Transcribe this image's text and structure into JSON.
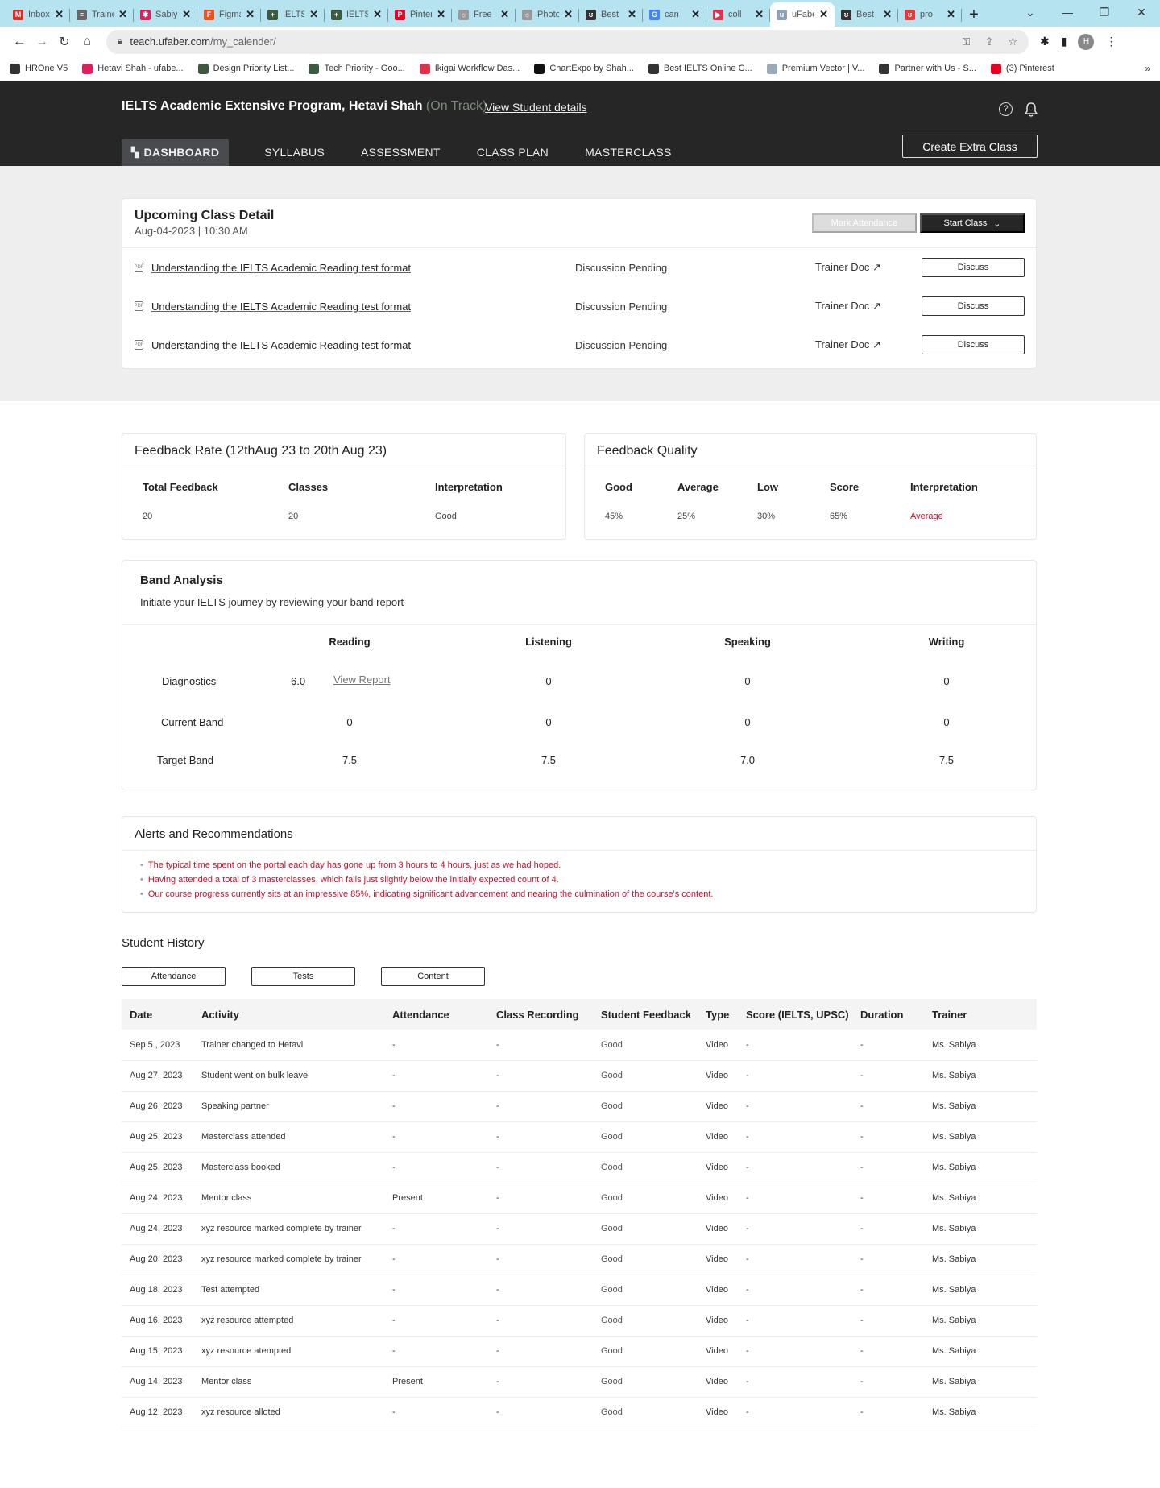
{
  "browser": {
    "tabs": [
      {
        "label": "Inbox",
        "icon": "gmail-icon",
        "color": "#d93025",
        "glyph": "M"
      },
      {
        "label": "Trainer",
        "icon": "document-icon",
        "color": "#666666",
        "glyph": "≡"
      },
      {
        "label": "Sabiya",
        "icon": "slack-icon",
        "color": "#e01e5a",
        "glyph": "✱"
      },
      {
        "label": "Figma",
        "icon": "figma-icon",
        "color": "#f24e1e",
        "glyph": "F"
      },
      {
        "label": "IELTS",
        "icon": "sheets-icon",
        "color": "#3e5a3e",
        "glyph": "+"
      },
      {
        "label": "IELTS",
        "icon": "sheets-icon",
        "color": "#3e5a3e",
        "glyph": "+"
      },
      {
        "label": "Pinterest",
        "icon": "pinterest-icon",
        "color": "#e60023",
        "glyph": "P"
      },
      {
        "label": "Free",
        "icon": "vector-icon",
        "color": "#999999",
        "glyph": "☼"
      },
      {
        "label": "Photo",
        "icon": "vector-icon",
        "color": "#999999",
        "glyph": "☼"
      },
      {
        "label": "Best",
        "icon": "ufaber-icon",
        "color": "#333333",
        "glyph": "ʊ"
      },
      {
        "label": "can",
        "icon": "google-icon",
        "color": "#4285f4",
        "glyph": "G"
      },
      {
        "label": "coll",
        "icon": "youtube-icon",
        "color": "#e62e4d",
        "glyph": "▶"
      },
      {
        "label": "uFaber",
        "icon": "ufaber-icon",
        "color": "#8fa3b8",
        "glyph": "u",
        "active": true
      },
      {
        "label": "Best",
        "icon": "ufaber-icon",
        "color": "#333333",
        "glyph": "ʊ"
      },
      {
        "label": "pro",
        "icon": "ufaber-icon",
        "color": "#e53935",
        "glyph": "ʊ"
      }
    ],
    "url_host": "teach.ufaber.com",
    "url_path": "/my_calender/",
    "avatar_letter": "H",
    "bookmarks": [
      {
        "label": "HROne V5",
        "color": "#333333"
      },
      {
        "label": "Hetavi Shah - ufabe...",
        "color": "#e01e5a"
      },
      {
        "label": "Design Priority List...",
        "color": "#3e5a3e"
      },
      {
        "label": "Tech Priority - Goo...",
        "color": "#3e5a3e"
      },
      {
        "label": "Ikigai Workflow Das...",
        "color": "#e0304a"
      },
      {
        "label": "ChartExpo by Shah...",
        "color": "#111111"
      },
      {
        "label": "Best IELTS Online C...",
        "color": "#333333"
      },
      {
        "label": "Premium Vector | V...",
        "color": "#9aaab8"
      },
      {
        "label": "Partner with Us - S...",
        "color": "#333333"
      },
      {
        "label": "(3) Pinterest",
        "color": "#e60023"
      }
    ],
    "bookmarks_more": "»"
  },
  "header": {
    "title": "IELTS Academic Extensive Program, Hetavi Shah",
    "status": "(On Track)",
    "view_student_details": "View Student details",
    "create_extra_class": "Create Extra Class",
    "nav": [
      {
        "label": "DASHBOARD",
        "active": true
      },
      {
        "label": "SYLLABUS"
      },
      {
        "label": "ASSESSMENT"
      },
      {
        "label": "CLASS PLAN"
      },
      {
        "label": "MASTERCLASS"
      }
    ]
  },
  "upcoming": {
    "title": "Upcoming Class Detail",
    "datetime": "Aug-04-2023 | 10:30 AM",
    "mark_attendance": "Mark Attendance",
    "start_class": "Start Class",
    "rows": [
      {
        "topic": "Understanding the IELTS Academic Reading test format",
        "status": "Discussion Pending",
        "doc": "Trainer Doc ↗",
        "action": "Discuss"
      },
      {
        "topic": "Understanding the IELTS Academic Reading test format",
        "status": "Discussion Pending",
        "doc": "Trainer Doc ↗",
        "action": "Discuss"
      },
      {
        "topic": "Understanding the IELTS Academic Reading test format",
        "status": "Discussion Pending",
        "doc": "Trainer Doc ↗",
        "action": "Discuss"
      }
    ]
  },
  "feedback_rate": {
    "title": "Feedback Rate (12thAug 23 to 20th Aug 23)",
    "columns": [
      "Total Feedback",
      "Classes",
      "Interpretation"
    ],
    "values": [
      "20",
      "20",
      "Good"
    ]
  },
  "feedback_quality": {
    "title": "Feedback Quality",
    "columns": [
      "Good",
      "Average",
      "Low",
      "Score",
      "Interpretation"
    ],
    "values": [
      "45%",
      "25%",
      "30%",
      "65%",
      "Average"
    ],
    "interpretation_color": "#c8102e"
  },
  "band": {
    "title": "Band Analysis",
    "subtitle": "Initiate your IELTS journey by reviewing your band report",
    "columns": [
      "Reading",
      "Listening",
      "Speaking",
      "Writing"
    ],
    "view_report": "View Report",
    "rows": [
      {
        "label": "Diagnostics",
        "reading_score": "6.0",
        "values": [
          "",
          "0",
          "0",
          "0"
        ]
      },
      {
        "label": "Current Band",
        "values": [
          "0",
          "0",
          "0",
          "0"
        ]
      },
      {
        "label": "Target Band",
        "values": [
          "7.5",
          "7.5",
          "7.0",
          "7.5"
        ]
      }
    ]
  },
  "alerts": {
    "title": "Alerts and Recommendations",
    "items": [
      "The typical time spent on the portal each day has gone up from 3 hours to 4 hours, just as we had hoped.",
      "Having attended a total of 3 masterclasses, which falls just slightly below the initially expected count of 4.",
      "Our course progress currently sits at an impressive 85%, indicating significant advancement and nearing the culmination of the course's content."
    ],
    "color": "#c8102e"
  },
  "history": {
    "title": "Student History",
    "filters": [
      "Attendance",
      "Tests",
      "Content"
    ],
    "columns": [
      "Date",
      "Activity",
      "Attendance",
      "Class Recording",
      "Student Feedback",
      "Type",
      "Score (IELTS, UPSC)",
      "Duration",
      "Trainer"
    ],
    "rows": [
      [
        "Sep 5 , 2023",
        "Trainer changed to Hetavi",
        "-",
        "-",
        "Good",
        "Video",
        "-",
        "-",
        "Ms. Sabiya"
      ],
      [
        "Aug 27, 2023",
        "Student went on bulk leave",
        "-",
        "-",
        "Good",
        "Video",
        "-",
        "-",
        "Ms. Sabiya"
      ],
      [
        "Aug 26, 2023",
        "Speaking partner",
        "-",
        "-",
        "Good",
        "Video",
        "-",
        "-",
        "Ms. Sabiya"
      ],
      [
        "Aug 25, 2023",
        "Masterclass attended",
        "-",
        "-",
        "Good",
        "Video",
        "-",
        "-",
        "Ms. Sabiya"
      ],
      [
        "Aug 25, 2023",
        "Masterclass booked",
        "-",
        "-",
        "Good",
        "Video",
        "-",
        "-",
        "Ms. Sabiya"
      ],
      [
        "Aug 24, 2023",
        "Mentor class",
        "Present",
        "-",
        "Good",
        "Video",
        "-",
        "-",
        "Ms. Sabiya"
      ],
      [
        "Aug 24, 2023",
        "xyz resource marked complete by trainer",
        "-",
        "-",
        "Good",
        "Video",
        "-",
        "-",
        "Ms. Sabiya"
      ],
      [
        "Aug 20, 2023",
        "xyz resource marked complete by trainer",
        "-",
        "-",
        "Good",
        "Video",
        "-",
        "-",
        "Ms. Sabiya"
      ],
      [
        "Aug 18, 2023",
        "Test attempted",
        "-",
        "-",
        "Good",
        "Video",
        "-",
        "-",
        "Ms. Sabiya"
      ],
      [
        "Aug 16, 2023",
        "xyz resource attempted",
        "-",
        "-",
        "Good",
        "Video",
        "-",
        "-",
        "Ms. Sabiya"
      ],
      [
        "Aug 15, 2023",
        "xyz resource atempted",
        "-",
        "-",
        "Good",
        "Video",
        "-",
        "-",
        "Ms. Sabiya"
      ],
      [
        "Aug 14, 2023",
        "Mentor class",
        "Present",
        "-",
        "Good",
        "Video",
        "-",
        "-",
        "Ms. Sabiya"
      ],
      [
        "Aug 12, 2023",
        "xyz resource alloted",
        "-",
        "-",
        "Good",
        "Video",
        "-",
        "-",
        "Ms. Sabiya"
      ]
    ]
  }
}
